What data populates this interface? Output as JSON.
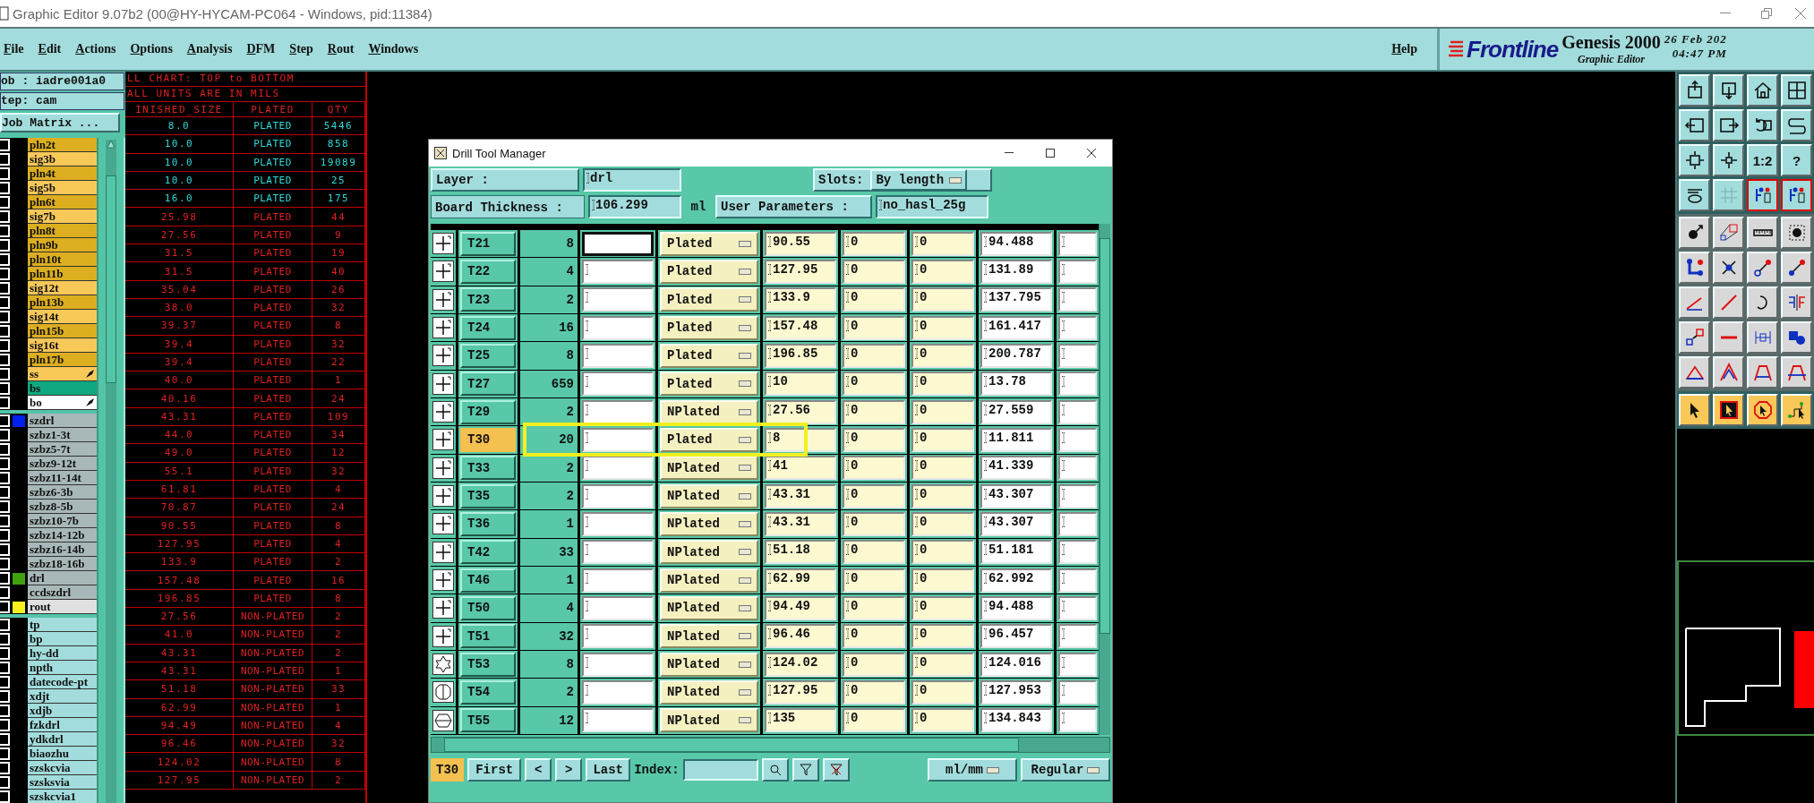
{
  "window": {
    "title": "Graphic Editor 9.07b2 (00@HY-HYCAM-PC064 - Windows, pid:11384)"
  },
  "menu": [
    {
      "label": "File"
    },
    {
      "label": "Edit"
    },
    {
      "label": "Actions"
    },
    {
      "label": "Options"
    },
    {
      "label": "Analysis"
    },
    {
      "label": "DFM"
    },
    {
      "label": "Step"
    },
    {
      "label": "Rout"
    },
    {
      "label": "Windows"
    }
  ],
  "help": "Help",
  "brand": {
    "logo": "Frontline",
    "product": "Genesis 2000",
    "subtitle": "Graphic Editor",
    "date": "26 Feb 202",
    "time": "04:47 PM"
  },
  "job_panel": {
    "job": "ob : iadre001a0",
    "step": "tep: cam",
    "matrix_button": "Job Matrix ..."
  },
  "layer_groups": [
    {
      "layers": [
        {
          "name": "pln2t",
          "kind": "dark",
          "checked": false
        },
        {
          "name": "sig3b",
          "kind": "light",
          "checked": false
        },
        {
          "name": "pln4t",
          "kind": "dark",
          "checked": false
        },
        {
          "name": "sig5b",
          "kind": "light",
          "checked": false
        },
        {
          "name": "pln6t",
          "kind": "dark",
          "checked": false
        },
        {
          "name": "sig7b",
          "kind": "light",
          "checked": false
        },
        {
          "name": "pln8t",
          "kind": "dark",
          "checked": false
        },
        {
          "name": "pln9b",
          "kind": "dark",
          "checked": false
        },
        {
          "name": "pln10t",
          "kind": "dark",
          "checked": false
        },
        {
          "name": "pln11b",
          "kind": "dark",
          "checked": false
        },
        {
          "name": "sig12t",
          "kind": "light",
          "checked": false
        },
        {
          "name": "pln13b",
          "kind": "dark",
          "checked": false
        },
        {
          "name": "sig14t",
          "kind": "light",
          "checked": false
        },
        {
          "name": "pln15b",
          "kind": "dark",
          "checked": false
        },
        {
          "name": "sig16t",
          "kind": "light",
          "checked": false
        },
        {
          "name": "pln17b",
          "kind": "dark",
          "checked": false
        },
        {
          "name": "ss",
          "kind": "mask",
          "checked": false,
          "flagged": true
        },
        {
          "name": "bs",
          "kind": "green",
          "checked": false
        },
        {
          "name": "bo",
          "kind": "white",
          "checked": false,
          "flagged": true
        }
      ]
    },
    {
      "layers": [
        {
          "name": "szdrl",
          "kind": "gray",
          "checked": false,
          "color": "#0020f0"
        },
        {
          "name": "szbz1-3t",
          "kind": "gray",
          "checked": false
        },
        {
          "name": "szbz5-7t",
          "kind": "gray",
          "checked": false
        },
        {
          "name": "szbz9-12t",
          "kind": "gray",
          "checked": false
        },
        {
          "name": "szbz11-14t",
          "kind": "gray",
          "checked": false
        },
        {
          "name": "szbz6-3b",
          "kind": "gray",
          "checked": false
        },
        {
          "name": "szbz8-5b",
          "kind": "gray",
          "checked": false
        },
        {
          "name": "szbz10-7b",
          "kind": "gray",
          "checked": false
        },
        {
          "name": "szbz14-12b",
          "kind": "gray",
          "checked": false
        },
        {
          "name": "szbz16-14b",
          "kind": "gray",
          "checked": false
        },
        {
          "name": "szbz18-16b",
          "kind": "gray",
          "checked": false
        },
        {
          "name": "drl",
          "kind": "gray",
          "checked": false,
          "color": "#40a010"
        },
        {
          "name": "ccdszdrl",
          "kind": "gray",
          "checked": false
        },
        {
          "name": "rout",
          "kind": "pale",
          "checked": false,
          "color": "#f8f020"
        }
      ]
    },
    {
      "layers": [
        {
          "name": "tp",
          "kind": "cyan",
          "checked": false
        },
        {
          "name": "bp",
          "kind": "cyan",
          "checked": false
        },
        {
          "name": "hy-dd",
          "kind": "cyan",
          "checked": false
        },
        {
          "name": "npth",
          "kind": "cyan",
          "checked": false
        },
        {
          "name": "datecode-pt",
          "kind": "cyan",
          "checked": false
        },
        {
          "name": "xdjt",
          "kind": "cyan",
          "checked": false
        },
        {
          "name": "xdjb",
          "kind": "cyan",
          "checked": false
        },
        {
          "name": "fzkdrl",
          "kind": "cyan",
          "checked": false
        },
        {
          "name": "ydkdrl",
          "kind": "cyan",
          "checked": false
        },
        {
          "name": "biaozhu",
          "kind": "cyan",
          "checked": false
        },
        {
          "name": "szskcvia",
          "kind": "cyan",
          "checked": false
        },
        {
          "name": "szsksvia",
          "kind": "cyan",
          "checked": false
        },
        {
          "name": "szskcvia1",
          "kind": "cyan",
          "checked": false
        }
      ]
    }
  ],
  "drill_chart": {
    "title": "LL CHART: TOP to BOTTOM",
    "units": "ALL UNITS ARE IN MILS",
    "columns": [
      "INISHED_SIZE",
      "PLATED",
      "QTY"
    ],
    "rows": [
      {
        "size": "8.0",
        "plating": "PLATED",
        "qty": "5446",
        "color": "#30d8d8"
      },
      {
        "size": "10.0",
        "plating": "PLATED",
        "qty": "858",
        "color": "#30d8d8"
      },
      {
        "size": "10.0",
        "plating": "PLATED",
        "qty": "19089",
        "color": "#30d8d8"
      },
      {
        "size": "10.0",
        "plating": "PLATED",
        "qty": "25",
        "color": "#30d8d8"
      },
      {
        "size": "16.0",
        "plating": "PLATED",
        "qty": "175",
        "color": "#30d8d8"
      },
      {
        "size": "25.98",
        "plating": "PLATED",
        "qty": "44",
        "color": "#e02020"
      },
      {
        "size": "27.56",
        "plating": "PLATED",
        "qty": "9",
        "color": "#e02020"
      },
      {
        "size": "31.5",
        "plating": "PLATED",
        "qty": "19",
        "color": "#e02020"
      },
      {
        "size": "31.5",
        "plating": "PLATED",
        "qty": "40",
        "color": "#e02020"
      },
      {
        "size": "35.04",
        "plating": "PLATED",
        "qty": "26",
        "color": "#e02020"
      },
      {
        "size": "38.0",
        "plating": "PLATED",
        "qty": "32",
        "color": "#e02020"
      },
      {
        "size": "39.37",
        "plating": "PLATED",
        "qty": "8",
        "color": "#e02020"
      },
      {
        "size": "39.4",
        "plating": "PLATED",
        "qty": "32",
        "color": "#e02020"
      },
      {
        "size": "39.4",
        "plating": "PLATED",
        "qty": "22",
        "color": "#e02020"
      },
      {
        "size": "40.0",
        "plating": "PLATED",
        "qty": "1",
        "color": "#e02020"
      },
      {
        "size": "40.16",
        "plating": "PLATED",
        "qty": "24",
        "color": "#e02020"
      },
      {
        "size": "43.31",
        "plating": "PLATED",
        "qty": "109",
        "color": "#e02020"
      },
      {
        "size": "44.0",
        "plating": "PLATED",
        "qty": "34",
        "color": "#e02020"
      },
      {
        "size": "49.0",
        "plating": "PLATED",
        "qty": "12",
        "color": "#e02020"
      },
      {
        "size": "55.1",
        "plating": "PLATED",
        "qty": "32",
        "color": "#e02020"
      },
      {
        "size": "61.81",
        "plating": "PLATED",
        "qty": "4",
        "color": "#e02020"
      },
      {
        "size": "70.87",
        "plating": "PLATED",
        "qty": "24",
        "color": "#e02020"
      },
      {
        "size": "90.55",
        "plating": "PLATED",
        "qty": "8",
        "color": "#e02020"
      },
      {
        "size": "127.95",
        "plating": "PLATED",
        "qty": "4",
        "color": "#e02020"
      },
      {
        "size": "133.9",
        "plating": "PLATED",
        "qty": "2",
        "color": "#e02020"
      },
      {
        "size": "157.48",
        "plating": "PLATED",
        "qty": "16",
        "color": "#e02020"
      },
      {
        "size": "196.85",
        "plating": "PLATED",
        "qty": "8",
        "color": "#e02020"
      },
      {
        "size": "27.56",
        "plating": "NON-PLATED",
        "qty": "2",
        "color": "#e02020"
      },
      {
        "size": "41.0",
        "plating": "NON-PLATED",
        "qty": "2",
        "color": "#e02020"
      },
      {
        "size": "43.31",
        "plating": "NON-PLATED",
        "qty": "2",
        "color": "#e02020"
      },
      {
        "size": "43.31",
        "plating": "NON-PLATED",
        "qty": "1",
        "color": "#e02020"
      },
      {
        "size": "51.18",
        "plating": "NON-PLATED",
        "qty": "33",
        "color": "#e02020"
      },
      {
        "size": "62.99",
        "plating": "NON-PLATED",
        "qty": "1",
        "color": "#e02020"
      },
      {
        "size": "94.49",
        "plating": "NON-PLATED",
        "qty": "4",
        "color": "#e02020"
      },
      {
        "size": "96.46",
        "plating": "NON-PLATED",
        "qty": "32",
        "color": "#e02020"
      },
      {
        "size": "124.02",
        "plating": "NON-PLATED",
        "qty": "8",
        "color": "#e02020"
      },
      {
        "size": "127.95",
        "plating": "NON-PLATED",
        "qty": "2",
        "color": "#e02020"
      }
    ]
  },
  "dialog": {
    "title": "Drill Tool Manager",
    "layer_label": "Layer :",
    "layer": "drl",
    "slots_label": "Slots:",
    "slots": "By length",
    "thickness_label": "Board Thickness :",
    "thickness": "106.299",
    "thickness_unit": "ml",
    "params_label": "User Parameters :",
    "params": "no_hasl_25g",
    "tools": [
      {
        "name": "T21",
        "kind": "round",
        "count": "8",
        "type": "Plated",
        "size": "90.55",
        "column_7": "0",
        "column_8": "0",
        "finish": "94.488",
        "selected": false,
        "highlighted": false,
        "focused": true
      },
      {
        "name": "T22",
        "kind": "round",
        "count": "4",
        "type": "Plated",
        "size": "127.95",
        "column_7": "0",
        "column_8": "0",
        "finish": "131.89",
        "selected": false,
        "highlighted": false,
        "focused": false
      },
      {
        "name": "T23",
        "kind": "round",
        "count": "2",
        "type": "Plated",
        "size": "133.9",
        "column_7": "0",
        "column_8": "0",
        "finish": "137.795",
        "selected": false,
        "highlighted": false,
        "focused": false
      },
      {
        "name": "T24",
        "kind": "round",
        "count": "16",
        "type": "Plated",
        "size": "157.48",
        "column_7": "0",
        "column_8": "0",
        "finish": "161.417",
        "selected": false,
        "highlighted": false,
        "focused": false
      },
      {
        "name": "T25",
        "kind": "round",
        "count": "8",
        "type": "Plated",
        "size": "196.85",
        "column_7": "0",
        "column_8": "0",
        "finish": "200.787",
        "selected": false,
        "highlighted": false,
        "focused": false
      },
      {
        "name": "T27",
        "kind": "round",
        "count": "659",
        "type": "Plated",
        "size": "10",
        "column_7": "0",
        "column_8": "0",
        "finish": "13.78",
        "selected": false,
        "highlighted": false,
        "focused": false
      },
      {
        "name": "T29",
        "kind": "round",
        "count": "2",
        "type": "NPlated",
        "size": "27.56",
        "column_7": "0",
        "column_8": "0",
        "finish": "27.559",
        "selected": false,
        "highlighted": false,
        "focused": false
      },
      {
        "name": "T30",
        "kind": "round",
        "count": "20",
        "type": "Plated",
        "size": "8",
        "column_7": "0",
        "column_8": "0",
        "finish": "11.811",
        "selected": true,
        "highlighted": true,
        "focused": false
      },
      {
        "name": "T33",
        "kind": "round",
        "count": "2",
        "type": "NPlated",
        "size": "41",
        "column_7": "0",
        "column_8": "0",
        "finish": "41.339",
        "selected": false,
        "highlighted": false,
        "focused": false
      },
      {
        "name": "T35",
        "kind": "round",
        "count": "2",
        "type": "NPlated",
        "size": "43.31",
        "column_7": "0",
        "column_8": "0",
        "finish": "43.307",
        "selected": false,
        "highlighted": false,
        "focused": false
      },
      {
        "name": "T36",
        "kind": "round",
        "count": "1",
        "type": "NPlated",
        "size": "43.31",
        "column_7": "0",
        "column_8": "0",
        "finish": "43.307",
        "selected": false,
        "highlighted": false,
        "focused": false
      },
      {
        "name": "T42",
        "kind": "round",
        "count": "33",
        "type": "NPlated",
        "size": "51.18",
        "column_7": "0",
        "column_8": "0",
        "finish": "51.181",
        "selected": false,
        "highlighted": false,
        "focused": false
      },
      {
        "name": "T46",
        "kind": "round",
        "count": "1",
        "type": "NPlated",
        "size": "62.99",
        "column_7": "0",
        "column_8": "0",
        "finish": "62.992",
        "selected": false,
        "highlighted": false,
        "focused": false
      },
      {
        "name": "T50",
        "kind": "round",
        "count": "4",
        "type": "NPlated",
        "size": "94.49",
        "column_7": "0",
        "column_8": "0",
        "finish": "94.488",
        "selected": false,
        "highlighted": false,
        "focused": false
      },
      {
        "name": "T51",
        "kind": "round",
        "count": "32",
        "type": "NPlated",
        "size": "96.46",
        "column_7": "0",
        "column_8": "0",
        "finish": "96.457",
        "selected": false,
        "highlighted": false,
        "focused": false
      },
      {
        "name": "T53",
        "kind": "star",
        "count": "8",
        "type": "NPlated",
        "size": "124.02",
        "column_7": "0",
        "column_8": "0",
        "finish": "124.016",
        "selected": false,
        "highlighted": false,
        "focused": false
      },
      {
        "name": "T54",
        "kind": "octagon",
        "count": "2",
        "type": "NPlated",
        "size": "127.95",
        "column_7": "0",
        "column_8": "0",
        "finish": "127.953",
        "selected": false,
        "highlighted": false,
        "focused": false
      },
      {
        "name": "T55",
        "kind": "hexagon",
        "count": "12",
        "type": "NPlated",
        "size": "135",
        "column_7": "0",
        "column_8": "0",
        "finish": "134.843",
        "selected": false,
        "highlighted": false,
        "focused": false
      }
    ],
    "footer": {
      "current": "T30",
      "first": "First",
      "prev": "<",
      "next": ">",
      "last": "Last",
      "index_label": "Index:",
      "units": "ml/mm",
      "mode": "Regular"
    }
  },
  "tool_groups": [
    {
      "kind": "view",
      "tools": [
        {
          "kind": "box-up",
          "on": false
        },
        {
          "kind": "box-down",
          "on": false
        },
        {
          "kind": "home",
          "on": false
        },
        {
          "kind": "window-grid",
          "on": false
        },
        {
          "kind": "box-left",
          "on": false
        },
        {
          "kind": "box-right",
          "on": false
        },
        {
          "kind": "undo",
          "on": false
        },
        {
          "kind": "s-curve",
          "on": false
        },
        {
          "kind": "fit",
          "on": false
        },
        {
          "kind": "zoom-center",
          "on": false
        },
        {
          "kind": "text",
          "label": "1:2",
          "on": false
        },
        {
          "kind": "text",
          "label": "?",
          "on": false
        },
        {
          "kind": "palette",
          "on": false
        },
        {
          "kind": "grid",
          "on": false
        },
        {
          "kind": "layers",
          "on": true
        },
        {
          "kind": "layers",
          "on": true
        }
      ]
    },
    {
      "kind": "edit",
      "tools": [
        {
          "kind": "dot-arrow",
          "on": false
        },
        {
          "kind": "squares-link",
          "on": false
        },
        {
          "kind": "ruler",
          "on": false
        },
        {
          "kind": "dot-dashed",
          "on": false
        },
        {
          "kind": "nodes",
          "on": false
        },
        {
          "kind": "cross-node",
          "on": false
        },
        {
          "kind": "pin-red",
          "on": false
        },
        {
          "kind": "pin-blue",
          "on": false
        },
        {
          "kind": "angle",
          "on": false
        },
        {
          "kind": "slash",
          "on": false
        },
        {
          "kind": "arc",
          "on": false
        },
        {
          "kind": "mirror",
          "on": false
        },
        {
          "kind": "square-arrow",
          "on": false
        },
        {
          "kind": "bar-line",
          "on": false
        },
        {
          "kind": "measure",
          "on": false
        },
        {
          "kind": "blobs",
          "on": false
        },
        {
          "kind": "triangle",
          "on": false
        },
        {
          "kind": "peak",
          "on": false
        },
        {
          "kind": "trapezoid",
          "on": false
        },
        {
          "kind": "trapezoid-cross",
          "on": false
        }
      ]
    },
    {
      "kind": "select",
      "tools": [
        {
          "kind": "cursor",
          "on": false
        },
        {
          "kind": "cursor-box",
          "on": false
        },
        {
          "kind": "cursor-octagon",
          "on": false
        },
        {
          "kind": "cursor-path",
          "on": false
        }
      ]
    }
  ]
}
